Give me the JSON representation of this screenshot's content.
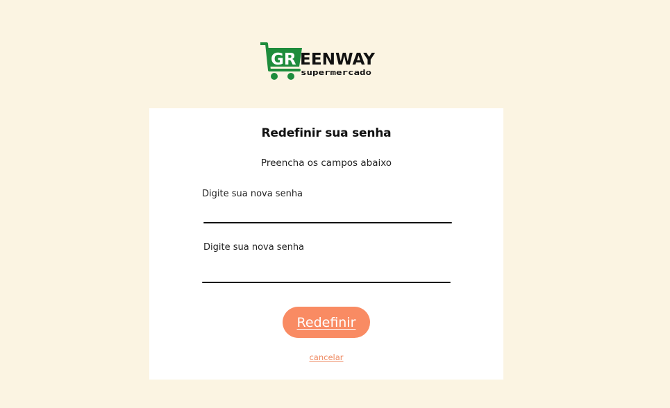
{
  "logo": {
    "letters_green": "GR",
    "letters_black": "EENWAY",
    "tagline": "supermercado",
    "green_color": "#1e8c3c"
  },
  "form": {
    "title": "Redefinir sua senha",
    "subtitle": "Preencha os campos abaixo",
    "fields": [
      {
        "label": "Digite sua nova senha",
        "value": ""
      },
      {
        "label": "Digite sua nova senha",
        "value": ""
      }
    ],
    "submit_label": "Redefinir",
    "cancel_label": "cancelar"
  },
  "colors": {
    "page_background": "#fbf4e2",
    "card_background": "#ffffff",
    "button": "#f98b63",
    "link": "#ee8a62"
  }
}
